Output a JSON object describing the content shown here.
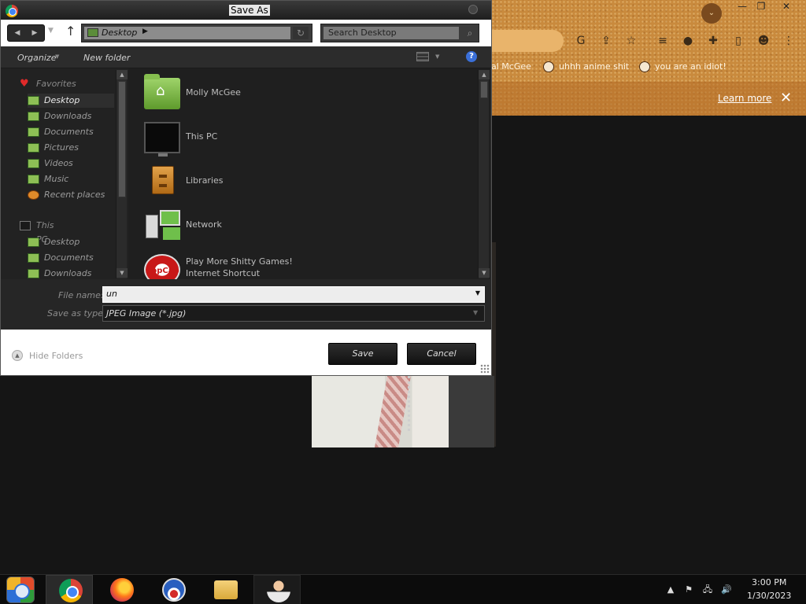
{
  "dialog": {
    "title": "Save As",
    "address": {
      "location": "Desktop"
    },
    "search": {
      "placeholder": "Search Desktop"
    },
    "toolbar": {
      "organize": "Organize",
      "new_folder": "New folder"
    },
    "nav_pane": {
      "favorites_header": "Favorites",
      "favorites": [
        "Desktop",
        "Downloads",
        "Documents",
        "Pictures",
        "Videos",
        "Music",
        "Recent places"
      ],
      "selected": "Desktop",
      "this_pc_header": "This PC",
      "this_pc": [
        "Desktop",
        "Documents",
        "Downloads"
      ]
    },
    "files": [
      {
        "name": "Molly McGee",
        "icon": "user-folder-icon"
      },
      {
        "name": "This PC",
        "icon": "computer-icon"
      },
      {
        "name": "Libraries",
        "icon": "libraries-icon"
      },
      {
        "name": "Network",
        "icon": "network-icon"
      },
      {
        "name": "Play More Shitty Games!",
        "subtitle": "Internet Shortcut",
        "icon": "popcap-icon"
      }
    ],
    "file_name": {
      "label": "File name:",
      "value": "un"
    },
    "save_type": {
      "label": "Save as type:",
      "value": "JPEG Image (*.jpg)"
    },
    "hide_folders": "Hide Folders",
    "save_button": "Save",
    "cancel_button": "Cancel"
  },
  "browser": {
    "bookmarks": [
      "al McGee",
      "uhhh anime shit",
      "you are an idiot!"
    ],
    "infobar": {
      "learn_more": "Learn more"
    }
  },
  "taskbar": {
    "apps": [
      "start-orb-icon",
      "chrome-icon",
      "firefox-icon",
      "obama-icon",
      "file-explorer-icon",
      "user-icon"
    ],
    "clock": {
      "time": "3:00 PM",
      "date": "1/30/2023"
    }
  },
  "colors": {
    "dialog_bg": "#2a2a2a",
    "accent_orange": "#c98a3d",
    "address_green": "#5b8d3a",
    "help_blue": "#3a6fd8"
  }
}
